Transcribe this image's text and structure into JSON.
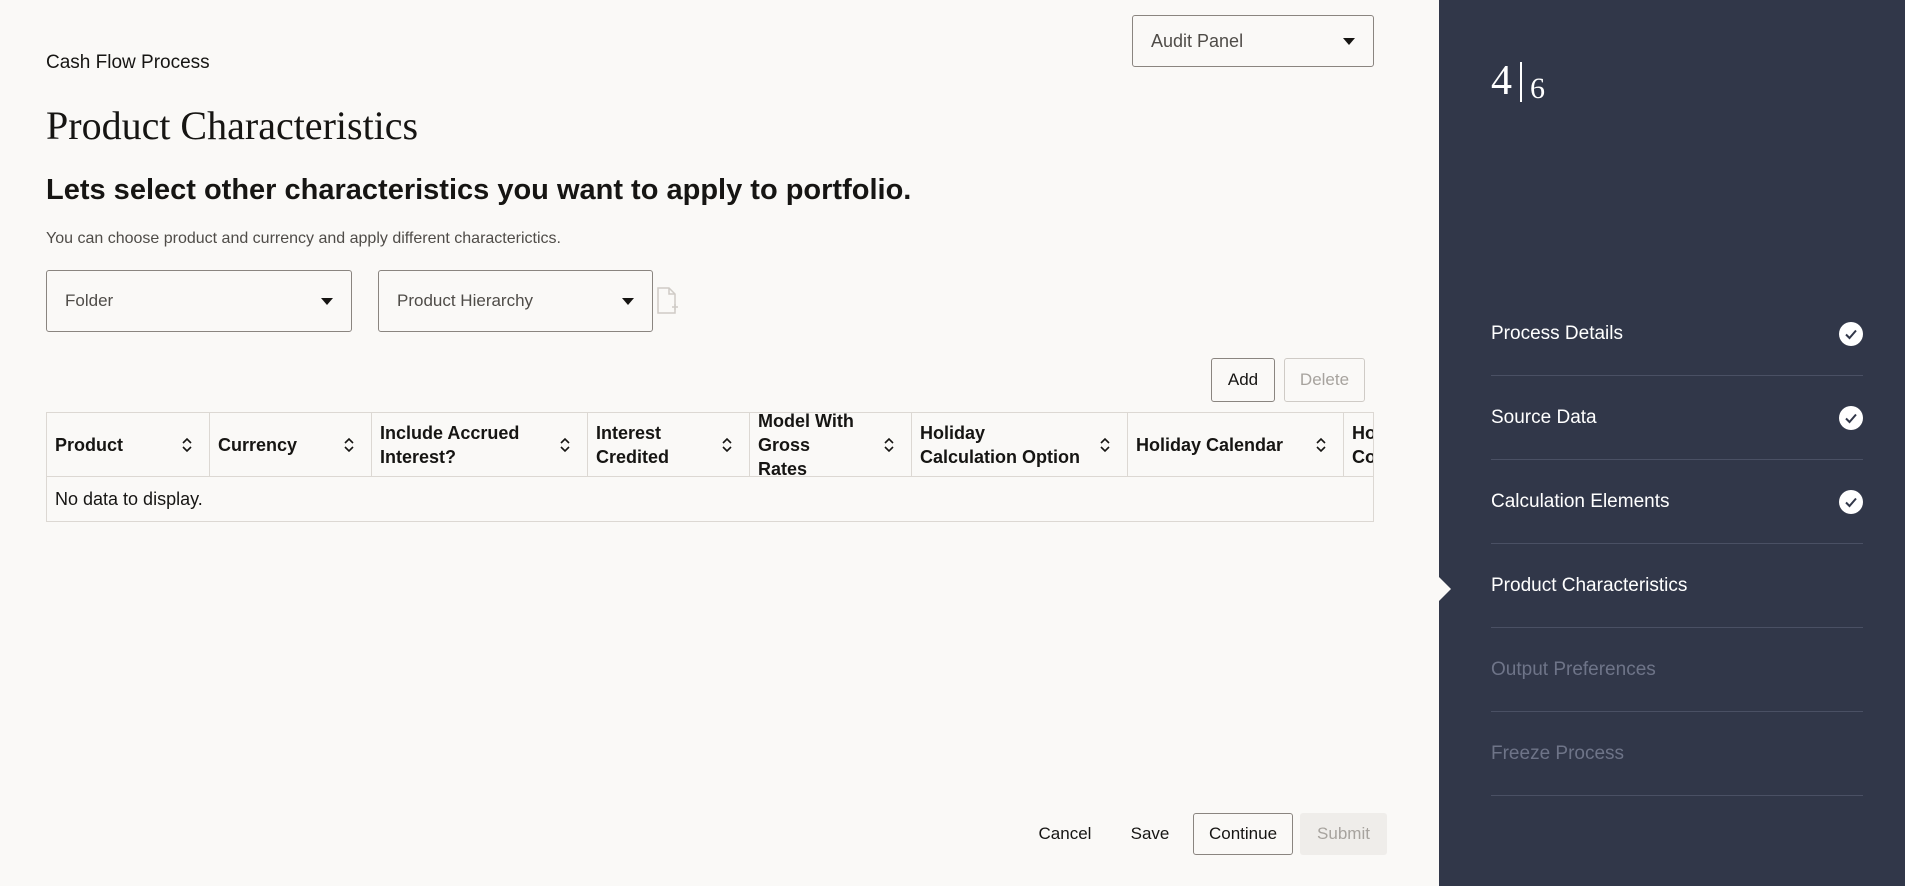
{
  "header": {
    "breadcrumb": "Cash Flow Process",
    "title": "Product Characteristics",
    "audit_panel": "Audit Panel"
  },
  "main": {
    "heading": "Lets select other characteristics you want to apply to portfolio.",
    "subtext": "You can choose product and currency and apply different characterictics.",
    "folder_select": "Folder",
    "hierarchy_select": "Product Hierarchy",
    "add_label": "Add",
    "delete_label": "Delete"
  },
  "table": {
    "columns": [
      "Product",
      "Currency",
      "Include Accrued Interest?",
      "Interest Credited",
      "Model With Gross Rates",
      "Holiday Calculation Option",
      "Holiday Calendar",
      "Holiday Convention"
    ],
    "empty_text": "No data to display."
  },
  "footer": {
    "cancel": "Cancel",
    "save": "Save",
    "continue": "Continue",
    "submit": "Submit"
  },
  "sidebar": {
    "current_step": "4",
    "total_steps": "6",
    "steps": [
      {
        "label": "Process Details",
        "status": "done"
      },
      {
        "label": "Source Data",
        "status": "done"
      },
      {
        "label": "Calculation Elements",
        "status": "done"
      },
      {
        "label": "Product Characteristics",
        "status": "current"
      },
      {
        "label": "Output Preferences",
        "status": "pending"
      },
      {
        "label": "Freeze Process",
        "status": "pending"
      }
    ]
  },
  "colors": {
    "sidebar_bg": "#313749",
    "page_bg": "#faf9f7",
    "text": "#161513",
    "pending_step": "#6e7488"
  }
}
